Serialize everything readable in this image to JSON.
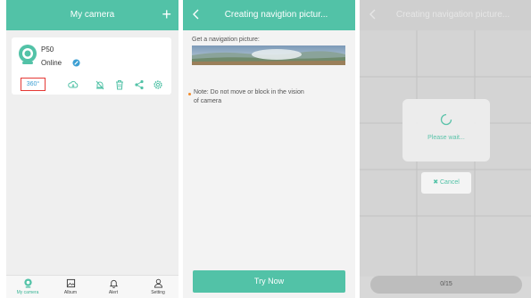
{
  "screen1": {
    "title": "My camera",
    "add_label": "+",
    "camera": {
      "name": "P50",
      "status": "Online"
    },
    "pano_button": "360°",
    "nav": [
      {
        "label": "My camera",
        "icon": "camera-nav-icon"
      },
      {
        "label": "Album",
        "icon": "album-icon"
      },
      {
        "label": "Alert",
        "icon": "bell-icon"
      },
      {
        "label": "Setting",
        "icon": "person-icon"
      }
    ]
  },
  "screen2": {
    "title": "Creating navigtion pictur...",
    "nav_label": "Get a navigation picture:",
    "note": "Note: Do not move or block in the vision of camera",
    "try_now": "Try Now"
  },
  "screen3": {
    "title": "Creating navigation picture...",
    "wait_text": "Please wait...",
    "cancel_label": "Cancel",
    "progress": "0/15"
  },
  "colors": {
    "accent": "#52c2a7",
    "highlight": "#e53935",
    "link": "#3c9fd3"
  }
}
